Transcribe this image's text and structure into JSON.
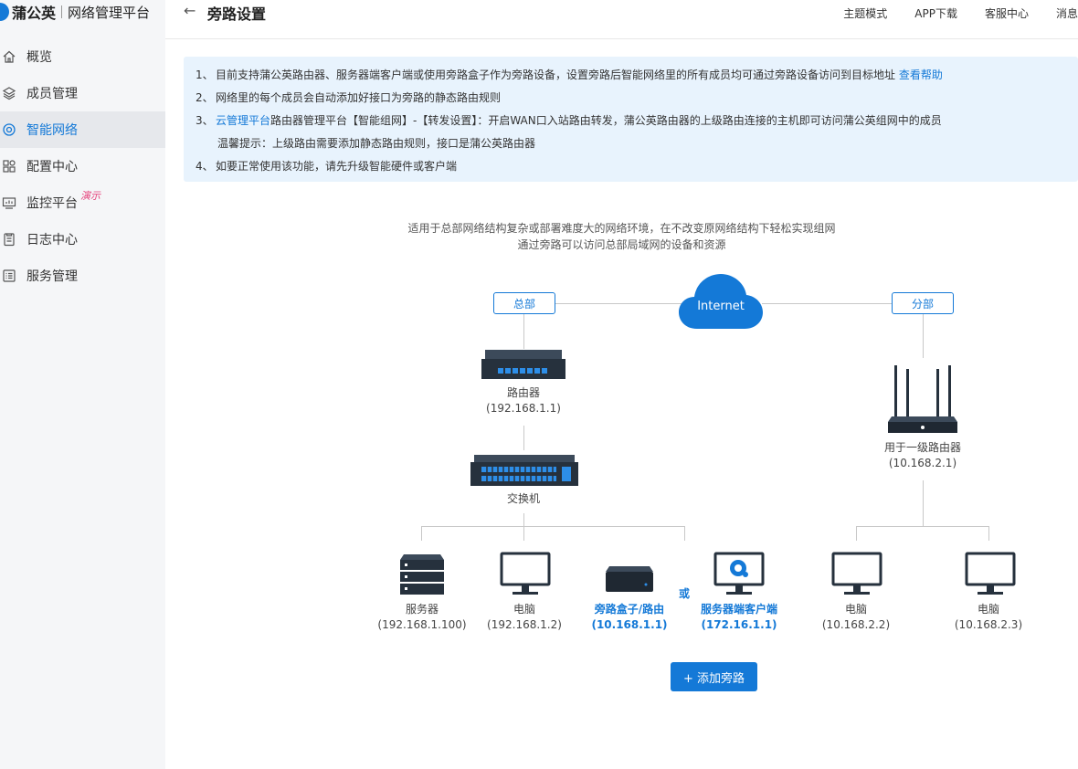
{
  "brand": {
    "name": "蒲公英",
    "subtitle": "网络管理平台"
  },
  "sidebar": {
    "items": [
      {
        "label": "概览",
        "icon": "home-icon"
      },
      {
        "label": "成员管理",
        "icon": "layers-icon"
      },
      {
        "label": "智能网络",
        "icon": "network-icon",
        "active": true
      },
      {
        "label": "配置中心",
        "icon": "grid-icon"
      },
      {
        "label": "监控平台",
        "icon": "monitor-icon",
        "badge": "演示"
      },
      {
        "label": "日志中心",
        "icon": "document-icon"
      },
      {
        "label": "服务管理",
        "icon": "list-icon"
      }
    ]
  },
  "header": {
    "back": "←",
    "title": "旁路设置",
    "links": [
      "主题模式",
      "APP下载",
      "客服中心",
      "消息"
    ]
  },
  "tips": {
    "t1_num": "1、",
    "t1_text": "目前支持蒲公英路由器、服务器端客户端或使用旁路盒子作为旁路设备，设置旁路后智能网络里的所有成员均可通过旁路设备访问到目标地址",
    "t1_link": "查看帮助",
    "t2_num": "2、",
    "t2_text": "网络里的每个成员会自动添加好接口为旁路的静态路由规则",
    "t3_num": "3、",
    "t3_link": "云管理平台",
    "t3_text": "路由器管理平台【智能组网】-【转发设置】：开启WAN口入站路由转发，蒲公英路由器的上级路由连接的主机即可访问蒲公英组网中的成员",
    "t3_hint": "温馨提示：上级路由需要添加静态路由规则，接口是蒲公英路由器",
    "t4_num": "4、",
    "t4_text": "如要正常使用该功能，请先升级智能硬件或客户端"
  },
  "diagram": {
    "desc1": "适用于总部网络结构复杂或部署难度大的网络环境，在不改变原网络结构下轻松实现组网",
    "desc2": "通过旁路可以访问总部局域网的设备和资源",
    "hq_tag": "总部",
    "branch_tag": "分部",
    "cloud": "Internet",
    "router_name": "路由器",
    "router_ip": "(192.168.1.1)",
    "switch_name": "交换机",
    "server_name": "服务器",
    "server_ip": "(192.168.1.100)",
    "pc1_name": "电脑",
    "pc1_ip": "(192.168.1.2)",
    "box_name": "旁路盒子/路由",
    "box_ip": "(10.168.1.1)",
    "or": "或",
    "client_name": "服务器端客户端",
    "client_ip": "(172.16.1.1)",
    "branch_router_name": "用于一级路由器",
    "branch_router_ip": "(10.168.2.1)",
    "pc2_name": "电脑",
    "pc2_ip": "(10.168.2.2)",
    "pc3_name": "电脑",
    "pc3_ip": "(10.168.2.3)"
  },
  "add_button": "+ 添加旁路",
  "colors": {
    "primary": "#1479d7",
    "tip_bg": "#e8f3fd",
    "sidebar_bg": "#f5f6f8",
    "badge": "#e6407a"
  }
}
